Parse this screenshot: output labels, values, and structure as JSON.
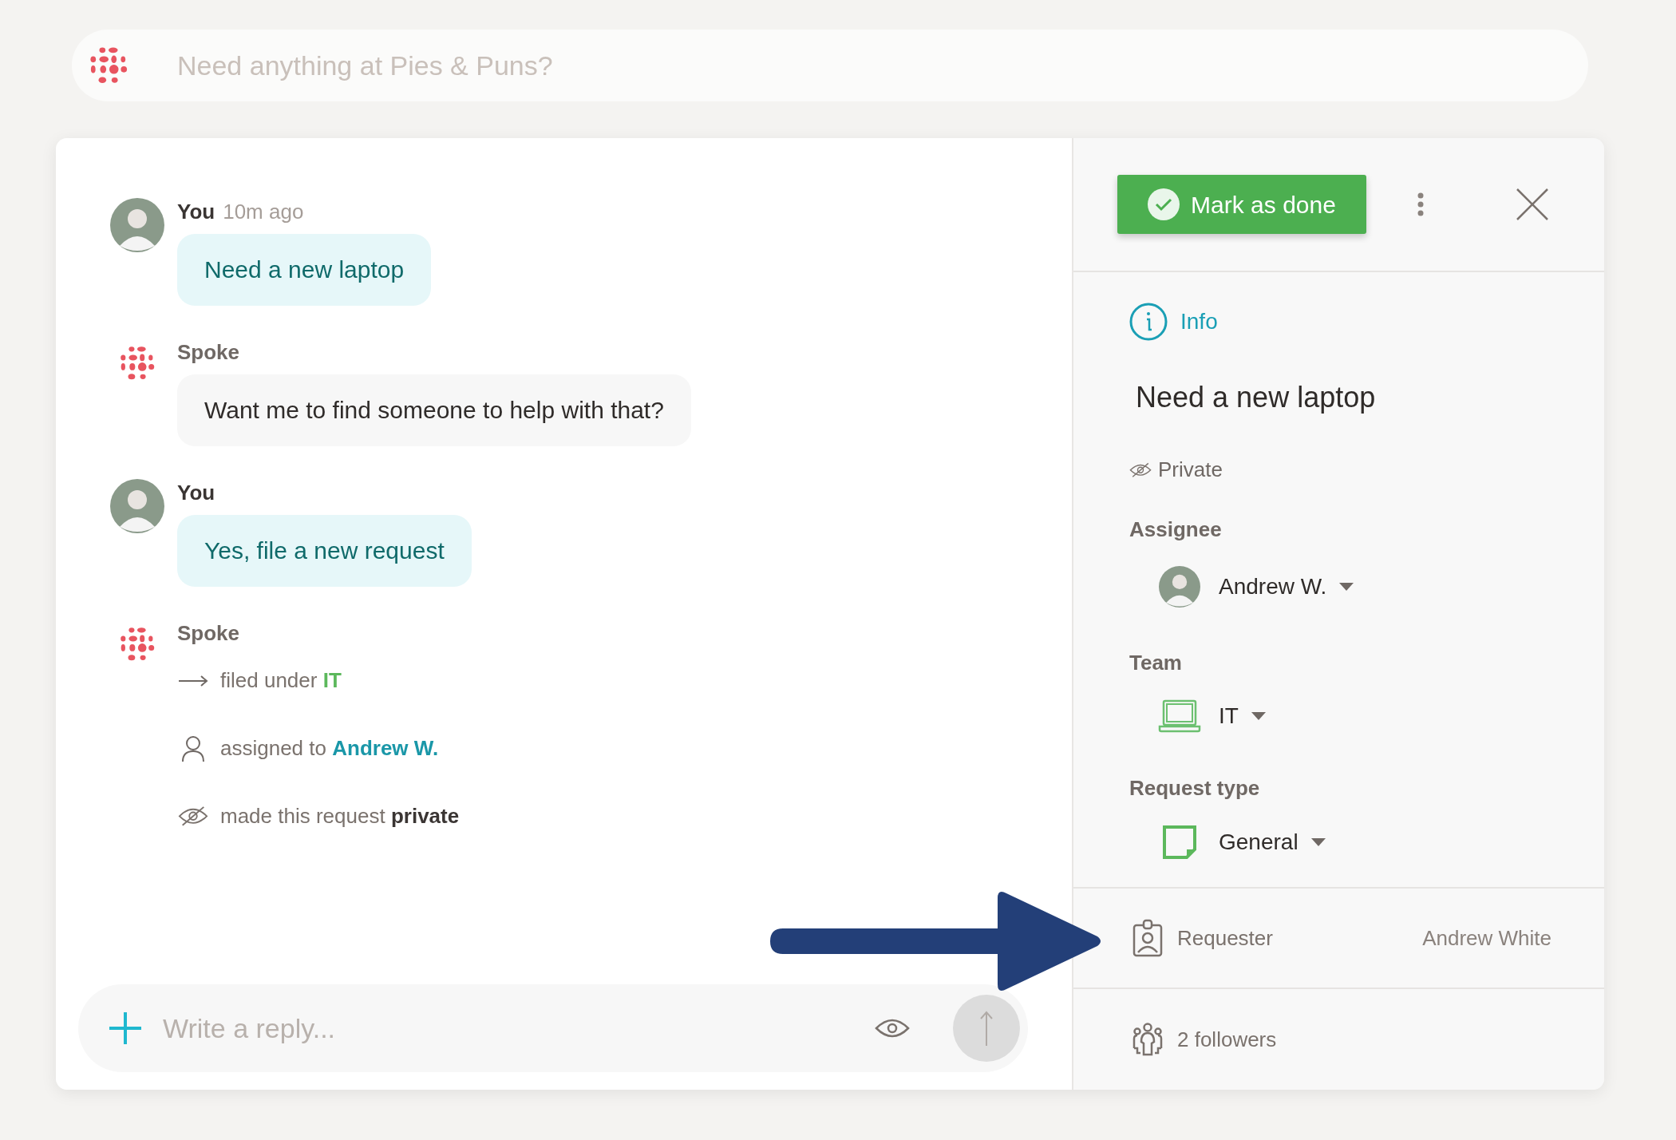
{
  "search": {
    "placeholder": "Need anything at Pies & Puns?"
  },
  "messages": [
    {
      "kind": "user",
      "author": "You",
      "time": "10m ago",
      "text": "Need a new laptop"
    },
    {
      "kind": "bot",
      "author": "Spoke",
      "text": "Want me to find someone to help with that?"
    },
    {
      "kind": "user",
      "author": "You",
      "text": "Yes, file a new request"
    },
    {
      "kind": "bot",
      "author": "Spoke",
      "events": [
        {
          "kind": "team",
          "text": "filed under",
          "value": "IT"
        },
        {
          "kind": "assignee",
          "text": "assigned to",
          "value": "Andrew W."
        },
        {
          "kind": "visibility",
          "text": "made this request",
          "value": "private"
        }
      ]
    }
  ],
  "reply": {
    "placeholder": "Write a reply..."
  },
  "panel": {
    "mark_done": "Mark as done",
    "info_tab": "Info",
    "title": "Need a new laptop",
    "visibility": "Private",
    "fields": [
      {
        "kind": "assignee",
        "label": "Assignee",
        "value": "Andrew W."
      },
      {
        "kind": "team",
        "label": "Team",
        "value": "IT"
      },
      {
        "kind": "request_type",
        "label": "Request type",
        "value": "General"
      }
    ],
    "requester": {
      "label": "Requester",
      "value": "Andrew White"
    },
    "followers": "2 followers"
  }
}
